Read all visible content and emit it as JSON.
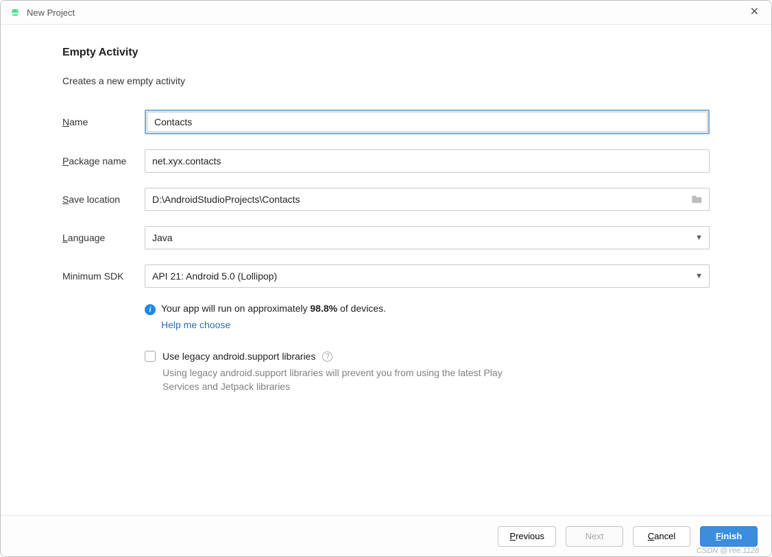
{
  "window": {
    "title": "New Project"
  },
  "page": {
    "heading": "Empty Activity",
    "subtitle": "Creates a new empty activity"
  },
  "form": {
    "name": {
      "label_pre": "N",
      "label_post": "ame",
      "value": "Contacts"
    },
    "package": {
      "label_pre": "P",
      "label_post": "ackage name",
      "value": "net.xyx.contacts"
    },
    "save": {
      "label_pre": "S",
      "label_post": "ave location",
      "value": "D:\\AndroidStudioProjects\\Contacts"
    },
    "language": {
      "label_pre": "L",
      "label_post": "anguage",
      "value": "Java"
    },
    "min_sdk": {
      "label": "Minimum SDK",
      "value": "API 21: Android 5.0 (Lollipop)"
    }
  },
  "info": {
    "text_pre": "Your app will run on approximately ",
    "percent": "98.8%",
    "text_post": " of devices.",
    "help_link": "Help me choose"
  },
  "legacy": {
    "checkbox_label": "Use legacy android.support libraries",
    "description": "Using legacy android.support libraries will prevent you from using the latest Play Services and Jetpack libraries"
  },
  "footer": {
    "previous_pre": "P",
    "previous_post": "revious",
    "next": "Next",
    "cancel_pre": "C",
    "cancel_post": "ancel",
    "finish_pre": "F",
    "finish_post": "inish"
  },
  "watermark": "CSDN @Yee.1128"
}
